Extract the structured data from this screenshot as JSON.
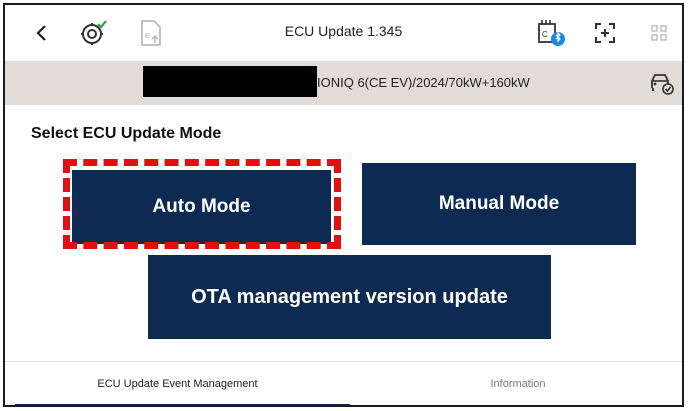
{
  "header": {
    "title": "ECU Update 1.345",
    "icons": [
      "back-chevron-icon",
      "vci-settings-icon",
      "document-upload-icon",
      "vci-bluetooth-icon",
      "screenshot-icon",
      "grid-menu-icon"
    ]
  },
  "vehicle": {
    "info": "IONIQ 6(CE EV)/2024/70kW+160kW",
    "icon": "car-check-icon"
  },
  "main": {
    "section_label": "Select ECU Update Mode",
    "auto_mode_label": "Auto Mode",
    "manual_mode_label": "Manual Mode",
    "ota_label": "OTA management version update"
  },
  "tabs": [
    {
      "label": "ECU Update Event Management",
      "active": true
    },
    {
      "label": "Information",
      "active": false
    }
  ],
  "colors": {
    "button_bg": "#0d2a52",
    "highlight": "#e01010",
    "vehicle_bar": "#e2dcd8"
  }
}
